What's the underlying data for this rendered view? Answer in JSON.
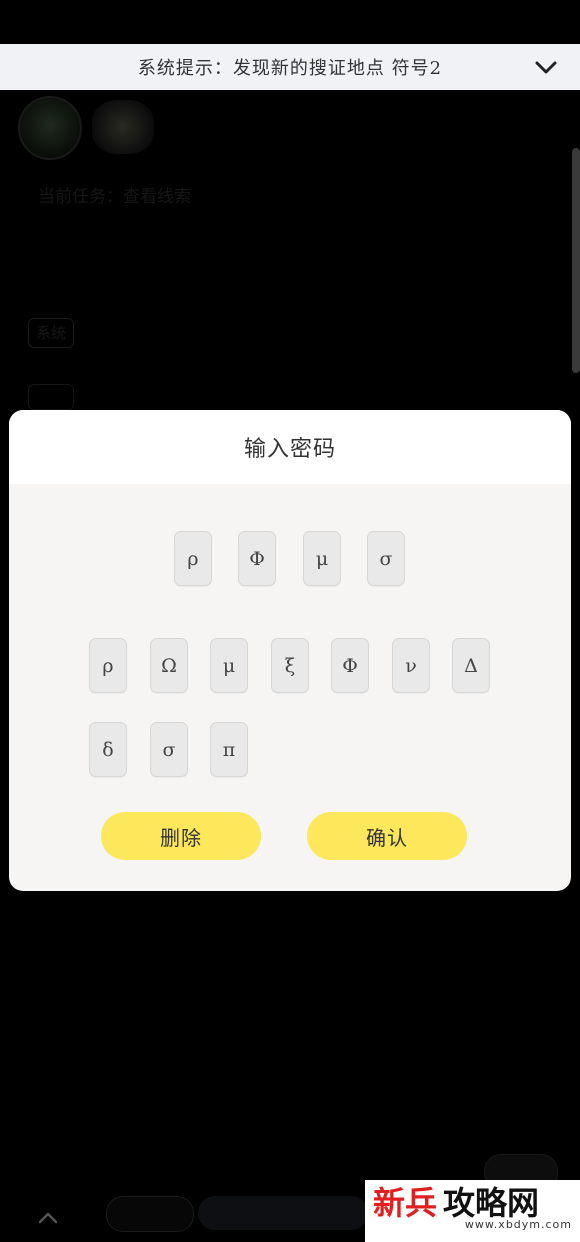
{
  "notification": {
    "text": "系统提示：发现新的搜证地点 符号2",
    "icon": "chevron-down-icon"
  },
  "background": {
    "line_text": "当前任务：查看线索",
    "side_tab_1": "系统",
    "up_icon": "chevron-up-icon"
  },
  "dialog": {
    "title": "输入密码",
    "entered": [
      "ρ",
      "Φ",
      "μ",
      "σ"
    ],
    "keys_row1": [
      "ρ",
      "Ω",
      "μ",
      "ξ",
      "Φ",
      "ν",
      "Δ"
    ],
    "keys_row2": [
      "δ",
      "σ",
      "π"
    ],
    "delete_label": "删除",
    "confirm_label": "确认"
  },
  "watermark": {
    "brand_red": "新兵",
    "brand_black": "攻略网",
    "url": "www.xbdym.com"
  },
  "colors": {
    "accent_yellow": "#fde75a",
    "overlay": "#000000"
  }
}
